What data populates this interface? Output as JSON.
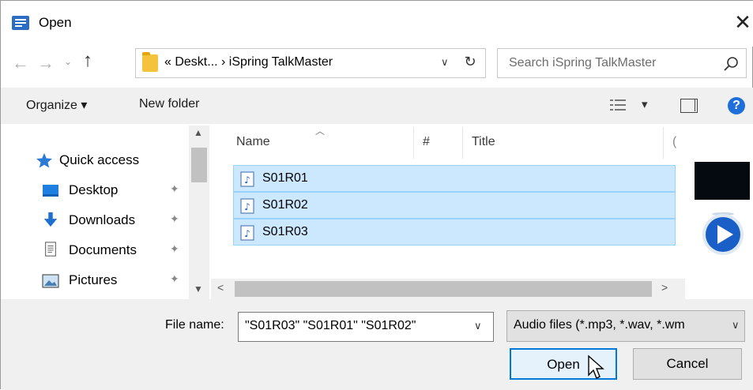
{
  "dialog": {
    "title": "Open",
    "close_glyph": "✕"
  },
  "nav": {
    "back_glyph": "←",
    "forward_glyph": "→",
    "recent_glyph": "⌄",
    "up_glyph": "↑",
    "address": "« Deskt...  ›  iSpring TalkMaster",
    "address_dropdown_glyph": "∨",
    "refresh_glyph": "↻",
    "search_placeholder": "Search iSpring TalkMaster"
  },
  "toolbar": {
    "organize_label": "Organize ▾",
    "new_folder_label": "New folder",
    "views_dropdown_glyph": "▾",
    "help_label": "?"
  },
  "sidebar": {
    "items": [
      {
        "label": "Quick access",
        "icon": "star-icon"
      },
      {
        "label": "Desktop",
        "icon": "desktop-icon",
        "pinned": true
      },
      {
        "label": "Downloads",
        "icon": "download-icon",
        "pinned": true
      },
      {
        "label": "Documents",
        "icon": "documents-icon",
        "pinned": true
      },
      {
        "label": "Pictures",
        "icon": "pictures-icon",
        "pinned": true
      }
    ],
    "pin_glyph": "📌"
  },
  "file_list": {
    "columns": [
      "Name",
      "#",
      "Title",
      "("
    ],
    "rows": [
      {
        "name": "S01R01",
        "selected": true
      },
      {
        "name": "S01R02",
        "selected": true
      },
      {
        "name": "S01R03",
        "selected": true
      }
    ]
  },
  "footer": {
    "file_name_label": "File name:",
    "file_name_value": "\"S01R03\" \"S01R01\" \"S01R02\"",
    "file_type_value": "Audio files (*.mp3, *.wav, *.wm",
    "open_label": "Open",
    "cancel_label": "Cancel"
  },
  "colors": {
    "selection_fill": "#cce8ff",
    "selection_border": "#99d1ff",
    "accent": "#0078d7"
  }
}
